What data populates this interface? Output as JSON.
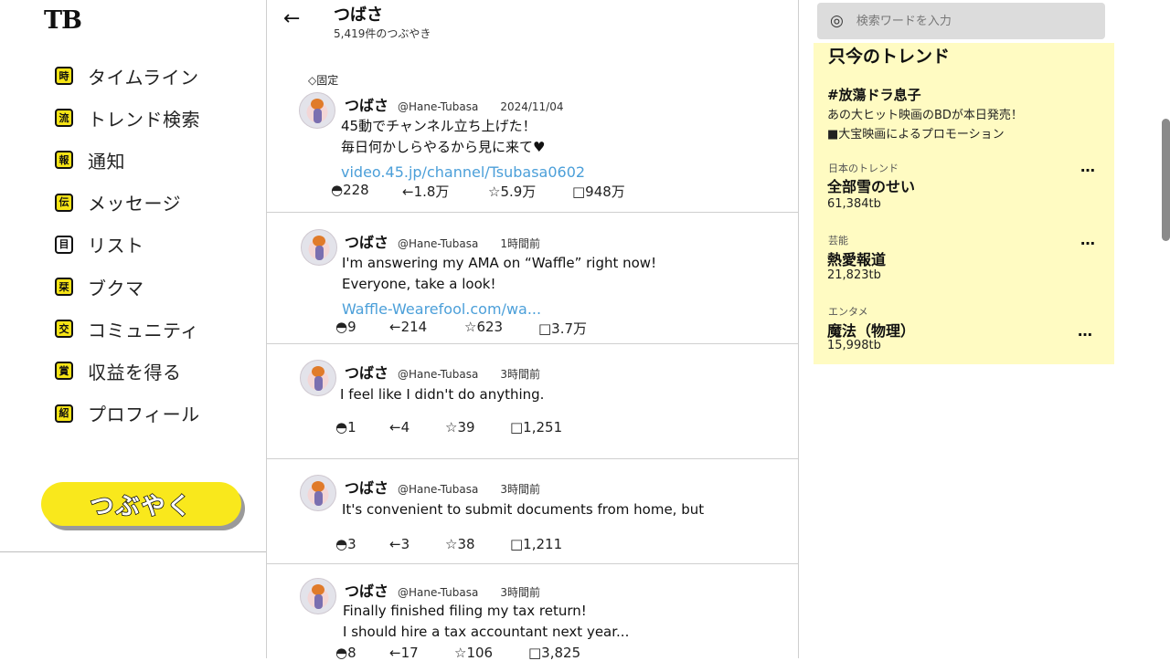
{
  "app": {
    "logo": "TB"
  },
  "nav": {
    "items": [
      {
        "icon_char": "時",
        "icon": "clock-icon",
        "label": "タイムライン"
      },
      {
        "icon_char": "流",
        "icon": "trend-icon",
        "label": "トレンド検索"
      },
      {
        "icon_char": "報",
        "icon": "bell-icon",
        "label": "通知"
      },
      {
        "icon_char": "伝",
        "icon": "message-icon",
        "label": "メッセージ"
      },
      {
        "icon_char": "目",
        "icon": "list-icon",
        "label": "リスト"
      },
      {
        "icon_char": "栞",
        "icon": "bookmark-icon",
        "label": "ブクマ"
      },
      {
        "icon_char": "交",
        "icon": "community-icon",
        "label": "コミュニティ"
      },
      {
        "icon_char": "賞",
        "icon": "money-icon",
        "label": "収益を得る"
      },
      {
        "icon_char": "紹",
        "icon": "profile-icon",
        "label": "プロフィール"
      }
    ],
    "post_button": "つぶやく"
  },
  "header": {
    "back": "←",
    "name": "つばさ",
    "count": "5,419件のつぶやき"
  },
  "tweets": [
    {
      "pinned": "◇固定",
      "name": "つばさ",
      "handle": "@Hane-Tubasa",
      "time": "2024/11/04",
      "lines": [
        "45動でチャンネル立ち上げた！",
        "毎日何かしらやるから見に来て♥"
      ],
      "link": "video.45.jp/channel/Tsubasa0602",
      "replies": "◓228",
      "reposts": "←1.8万",
      "likes": "☆5.9万",
      "views": "□948万"
    },
    {
      "name": "つばさ",
      "handle": "@Hane-Tubasa",
      "time": "1時間前",
      "lines": [
        "I'm answering my AMA on “Waffle” right now!",
        "Everyone, take a look!"
      ],
      "link": "Waffle-Wearefool.com/wa...",
      "replies": "◓9",
      "reposts": "←214",
      "likes": "☆623",
      "views": "□3.7万"
    },
    {
      "name": "つばさ",
      "handle": "@Hane-Tubasa",
      "time": "3時間前",
      "lines": [
        "I feel like I didn't do anything."
      ],
      "replies": "◓1",
      "reposts": "←4",
      "likes": "☆39",
      "views": "□1,251"
    },
    {
      "name": "つばさ",
      "handle": "@Hane-Tubasa",
      "time": "3時間前",
      "lines": [
        "It's convenient to submit documents from home, but"
      ],
      "replies": "◓3",
      "reposts": "←3",
      "likes": "☆38",
      "views": "□1,211"
    },
    {
      "name": "つばさ",
      "handle": "@Hane-Tubasa",
      "time": "3時間前",
      "lines": [
        "Finally finished filing my tax return!",
        "I should hire a tax accountant next year..."
      ],
      "replies": "◓8",
      "reposts": "←17",
      "likes": "☆106",
      "views": "□3,825"
    }
  ],
  "search": {
    "icon_char": "◎",
    "icon": "search-icon",
    "placeholder": "検索ワードを入力"
  },
  "trends": {
    "title": "只今のトレンド",
    "promo": {
      "tag": "#放蕩ドラ息子",
      "line1": "あの大ヒット映画のBDが本日発売！",
      "line2": "■大宝映画によるプロモーション"
    },
    "items": [
      {
        "category": "日本のトレンド",
        "name": "全部雪のせい",
        "count": "61,384tb",
        "more": "…"
      },
      {
        "category": "芸能",
        "name": "熱愛報道",
        "count": "21,823tb",
        "more": "…"
      },
      {
        "category": "エンタメ",
        "name": "魔法（物理）",
        "count": "15,998tb",
        "more": "…"
      }
    ]
  },
  "colors": {
    "accent_yellow": "#f9e81c",
    "trend_bg": "#fffbc2",
    "link_blue": "#4b9fd9"
  }
}
